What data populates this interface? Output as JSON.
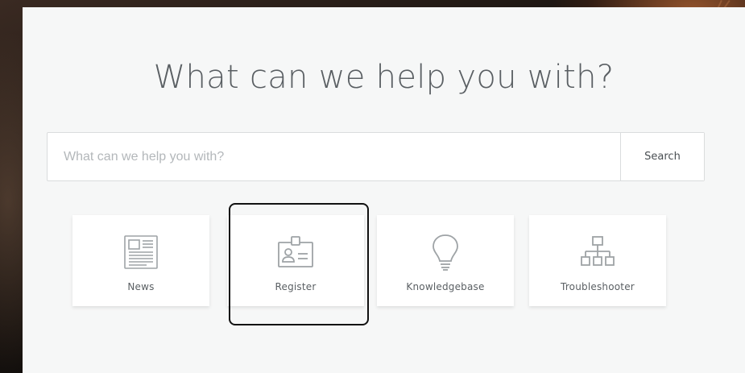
{
  "page": {
    "headline": "What can we help you with?"
  },
  "search": {
    "placeholder": "What can we help you with?",
    "value": "",
    "button_label": "Search"
  },
  "tiles": [
    {
      "label": "News",
      "icon": "newspaper-icon"
    },
    {
      "label": "Register",
      "icon": "id-card-icon"
    },
    {
      "label": "Knowledgebase",
      "icon": "lightbulb-icon"
    },
    {
      "label": "Troubleshooter",
      "icon": "sitemap-icon"
    }
  ],
  "colors": {
    "panel_bg": "#f6f7f7",
    "headline": "#5a5f63",
    "icon": "#9ea3a6",
    "highlight_border": "#111111"
  }
}
